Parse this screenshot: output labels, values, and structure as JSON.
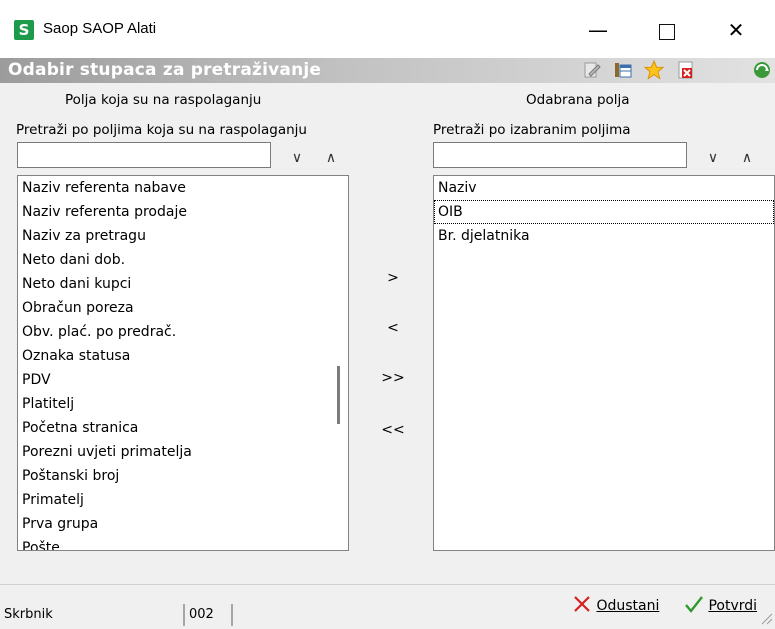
{
  "window": {
    "logo": "S",
    "title": "Saop SAOP Alati",
    "minimize": "—",
    "close": "✕"
  },
  "header": {
    "title": "Odabir stupaca za pretraživanje",
    "tools": [
      "edit-icon",
      "columns-icon",
      "favorite-star-icon",
      "delete-report-icon",
      "refresh-icon"
    ]
  },
  "available": {
    "heading": "Polja koja su na raspolaganju",
    "search_label": "Pretraži po poljima koja su na raspolaganju",
    "search_value": "",
    "items": [
      "Naziv referenta nabave",
      "Naziv referenta prodaje",
      "Naziv za pretragu",
      "Neto dani dob.",
      "Neto dani kupci",
      "Obračun poreza",
      "Obv. plać. po predrač.",
      "Oznaka statusa",
      "PDV",
      "Platitelj",
      "Početna stranica",
      "Porezni uvjeti primatelja",
      "Poštanski broj",
      "Primatelj",
      "Prva grupa",
      "Pošte..."
    ]
  },
  "selected": {
    "heading": "Odabrana polja",
    "search_label": "Pretraži po izabranim poljima",
    "search_value": "",
    "items": [
      "Naziv",
      "OIB",
      "Br. djelatnika"
    ],
    "focused_index": 1
  },
  "move": {
    "add": ">",
    "remove": "<",
    "add_all": ">>",
    "remove_all": "<<"
  },
  "arrows": {
    "down": "∨",
    "up": "∧"
  },
  "actions": {
    "cancel": "Odustani",
    "confirm": "Potvrdi",
    "cancel_color": "#d62020",
    "confirm_color": "#2e9b2e"
  },
  "status": {
    "user": "Skrbnik",
    "code": "002"
  }
}
